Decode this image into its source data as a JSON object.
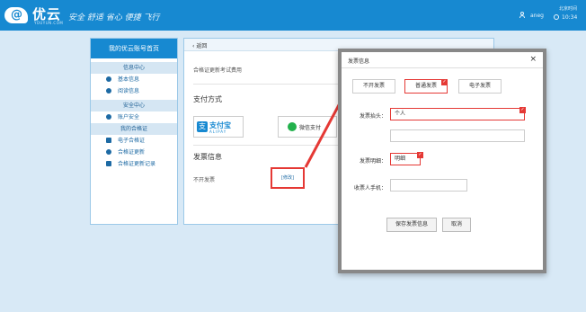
{
  "header": {
    "logo_text": "优云",
    "logo_sub": "YOUYUN.COM",
    "slogan": "安全 舒适 省心 便捷 飞行",
    "username": "aneg",
    "time_label": "北京时间",
    "time": "10:34"
  },
  "sidebar": {
    "title": "我的优云账号首页",
    "sections": [
      {
        "title": "信息中心",
        "items": [
          {
            "label": "基本信息"
          },
          {
            "label": "阅读信息"
          }
        ]
      },
      {
        "title": "安全中心",
        "items": [
          {
            "label": "账户安全"
          }
        ]
      },
      {
        "title": "我的合格证",
        "items": [
          {
            "label": "电子合格证"
          },
          {
            "label": "合格证更新"
          },
          {
            "label": "合格证更新记录"
          }
        ]
      }
    ]
  },
  "content": {
    "back_label": "返回",
    "cert_text": "合格证更新考试费用",
    "payment_title": "支付方式",
    "alipay_label": "支付宝",
    "alipay_sub": "ALIPAY",
    "wechat_label": "微信支付",
    "invoice_title": "发票信息",
    "invoice_status": "不开发票",
    "modify_label": "[修改]"
  },
  "modal": {
    "title": "发票信息",
    "close_icon": "×",
    "options": [
      {
        "label": "不开发票",
        "active": false
      },
      {
        "label": "普通发票",
        "active": true
      },
      {
        "label": "电子发票",
        "active": false
      }
    ],
    "header_label": "发票抬头：",
    "header_value": "个人",
    "detail_label": "发票明细：",
    "detail_value": "明细",
    "phone_label": "收票人手机：",
    "phone_value": "",
    "save_label": "保存发票信息",
    "cancel_label": "取消"
  },
  "colors": {
    "brand_blue": "#1789d1",
    "highlight_red": "#e53935"
  }
}
